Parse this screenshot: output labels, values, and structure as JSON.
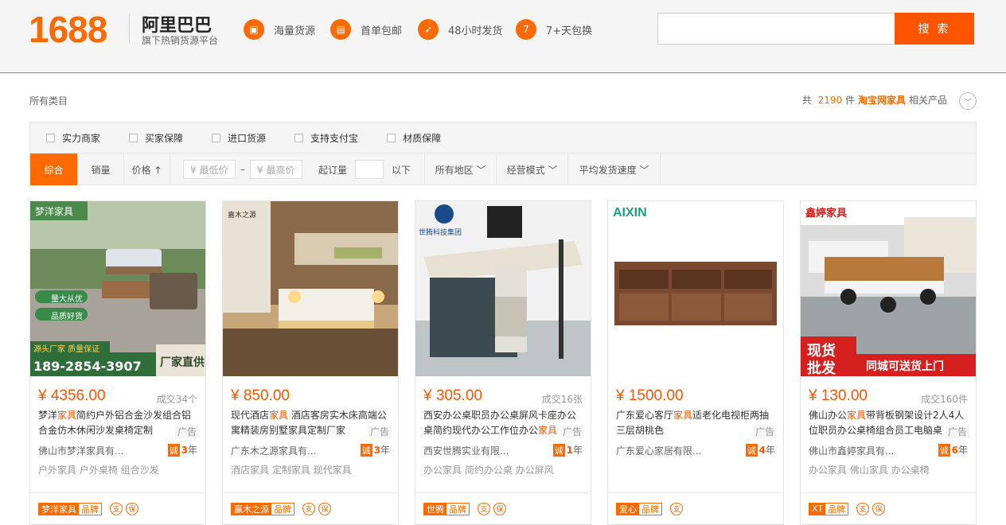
{
  "header": {
    "logo_number": "1688",
    "logo_name": "阿里巴巴",
    "logo_sub": "旗下热销货源平台",
    "features": [
      {
        "icon": "cube-icon",
        "glyph": "▣",
        "label": "海量货源"
      },
      {
        "icon": "truck-icon",
        "glyph": "🚚",
        "label": "首单包邮"
      },
      {
        "icon": "rocket-icon",
        "glyph": "➶",
        "label": "48小时发货"
      },
      {
        "icon": "shield-icon",
        "glyph": "7",
        "label": "7+天包换"
      }
    ],
    "search_placeholder": "",
    "search_button": "搜 索"
  },
  "crumb": "所有类目",
  "result": {
    "prefix": "共",
    "count": "2190",
    "unit": "件",
    "keyword": "淘宝网家具",
    "suffix": "相关产品"
  },
  "filters": {
    "checkboxes": [
      "实力商家",
      "买家保障",
      "进口货源",
      "支持支付宝",
      "材质保障"
    ],
    "sort_default": "综合",
    "sort_sales": "销量",
    "sort_price": "价格 ↑",
    "price_min_placeholder": "¥ 最低价",
    "price_dash": "–",
    "price_max_placeholder": "¥ 最高价",
    "moq_label": "起订量",
    "moq_suffix": "以下",
    "region": "所有地区 ﹀",
    "mode": "经营模式 ﹀",
    "speed": "平均发货速度 ﹀"
  },
  "products": [
    {
      "price": "¥ 4356.00",
      "deals": "成交34个",
      "title_pre": "梦洋",
      "title_kw": "家具",
      "title_post": "简约户外铝合金沙发组合铝合金仿木休闲沙发桌椅定制",
      "ad": "广告",
      "company": "佛山市梦洋家具有...",
      "cheng_badge": "诚",
      "years": "3",
      "year_unit": "年",
      "tags": "户外家具 户外桌椅 组合沙发",
      "brand": "梦洋家具",
      "brand_tag": "品牌",
      "minis": [
        "支",
        "保"
      ],
      "img_brand": "梦洋家具",
      "img_phone": "189-2854-3907",
      "img_cta": "厂家直供",
      "img_tag1": "量大从优",
      "img_tag2": "品质好货",
      "img_tag3": "源头厂家  质量保证"
    },
    {
      "price": "¥ 850.00",
      "deals": "",
      "title_pre": "现代酒店",
      "title_kw": "家具",
      "title_post": " 酒店客房实木床高端公寓精装房别墅家具定制厂家",
      "ad": "广告",
      "company": "广东木之源家具有...",
      "cheng_badge": "诚",
      "years": "3",
      "year_unit": "年",
      "tags": "酒店家具 定制家具 现代家具",
      "brand": "赢木之源",
      "brand_tag": "品牌",
      "minis": [
        "支",
        "保"
      ],
      "img_brand": "嘉木之源"
    },
    {
      "price": "¥ 305.00",
      "deals": "成交16张",
      "title_pre": "西安办公桌职员办公桌屏风卡座办公桌简约现代办公工作位办公",
      "title_kw": "家具",
      "title_post": "",
      "ad": "广告",
      "company": "西安世腾实业有限...",
      "cheng_badge": "诚",
      "years": "1",
      "year_unit": "年",
      "tags": "办公家具 简约办公桌 办公屏风",
      "brand": "世腾",
      "brand_tag": "品牌",
      "minis": [
        "支",
        "保"
      ],
      "img_brand": "世腾科技集团"
    },
    {
      "price": "¥ 1500.00",
      "deals": "",
      "title_pre": "广东爱心客厅",
      "title_kw": "家具",
      "title_post": "适老化电视柜两抽三层胡桃色",
      "ad": "广告",
      "company": "广东爱心家居有限...",
      "cheng_badge": "诚",
      "years": "4",
      "year_unit": "年",
      "tags": "",
      "brand": "爱心",
      "brand_tag": "品牌",
      "minis": [
        "支"
      ],
      "img_brand": "AIXIN"
    },
    {
      "price": "¥ 130.00",
      "deals": "成交160件",
      "title_pre": "佛山办公",
      "title_kw": "家具",
      "title_post": "带背板钢架设计2人4人位职员办公桌椅组合员工电脑桌",
      "ad": "广告",
      "company": "佛山市鑫婷家具有...",
      "cheng_badge": "诚",
      "years": "6",
      "year_unit": "年",
      "tags": "办公家具 佛山家具 办公桌椅",
      "brand": "XT",
      "brand_tag": "品牌",
      "minis": [
        "支",
        "保"
      ],
      "img_brand": "鑫婷家具",
      "img_promo1": "现货",
      "img_promo2": "批发",
      "img_promo3": "同城可送货上门"
    }
  ]
}
